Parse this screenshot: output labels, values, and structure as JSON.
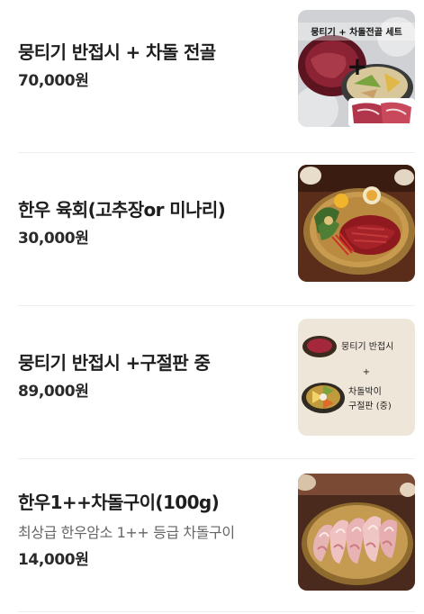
{
  "menu": {
    "items": [
      {
        "name": "뭉티기 반접시 + 차돌 전골",
        "price": "70,000원",
        "image_text_top": "뭉티기 + 차돌전골 세트",
        "image_plus": "+"
      },
      {
        "name": "한우 육회(고추장or 미나리)",
        "price": "30,000원"
      },
      {
        "name": "뭉티기 반접시 +구절판 중",
        "price": "89,000원",
        "image_line1": "뭉티기 반접시",
        "image_plus": "+",
        "image_line2": "차돌박이",
        "image_line3": "구절판 (중)"
      },
      {
        "name": "한우1++차돌구이(100g)",
        "description": "최상급 한우암소 1++ 등급 차돌구이",
        "price": "14,000원"
      }
    ]
  }
}
